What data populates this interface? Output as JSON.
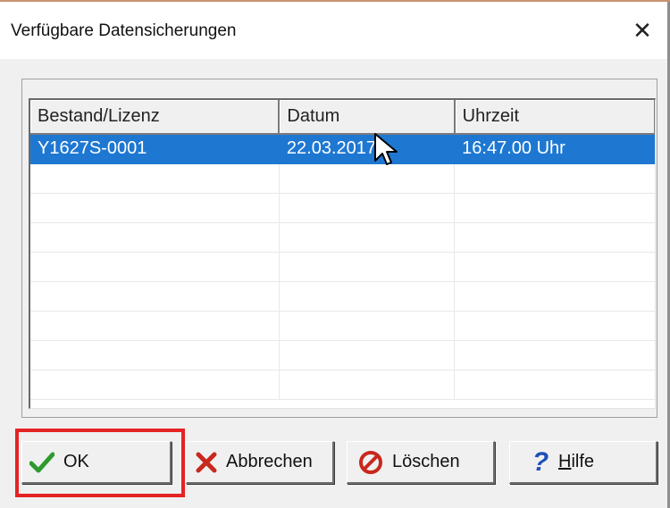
{
  "dialog": {
    "title": "Verfügbare Datensicherungen",
    "close_glyph": "✕"
  },
  "table": {
    "columns": [
      "Bestand/Lizenz",
      "Datum",
      "Uhrzeit"
    ],
    "rows": [
      {
        "license": "Y1627S-0001",
        "date": "22.03.2017",
        "time": "16:47.00 Uhr",
        "selected": true
      }
    ],
    "empty_rows": 8
  },
  "buttons": {
    "ok": {
      "label": "OK",
      "icon": "check-icon"
    },
    "cancel": {
      "label": "Abbrechen",
      "icon": "cross-icon"
    },
    "delete": {
      "label": "Löschen",
      "icon": "no-entry-icon"
    },
    "help": {
      "label_first": "H",
      "label_rest": "ilfe",
      "icon": "question-icon"
    }
  },
  "colors": {
    "selection": "#1e78d2",
    "annotation": "#e52323",
    "check": "#2e9a2e",
    "cross": "#c8281e",
    "help": "#1d4fb8"
  }
}
